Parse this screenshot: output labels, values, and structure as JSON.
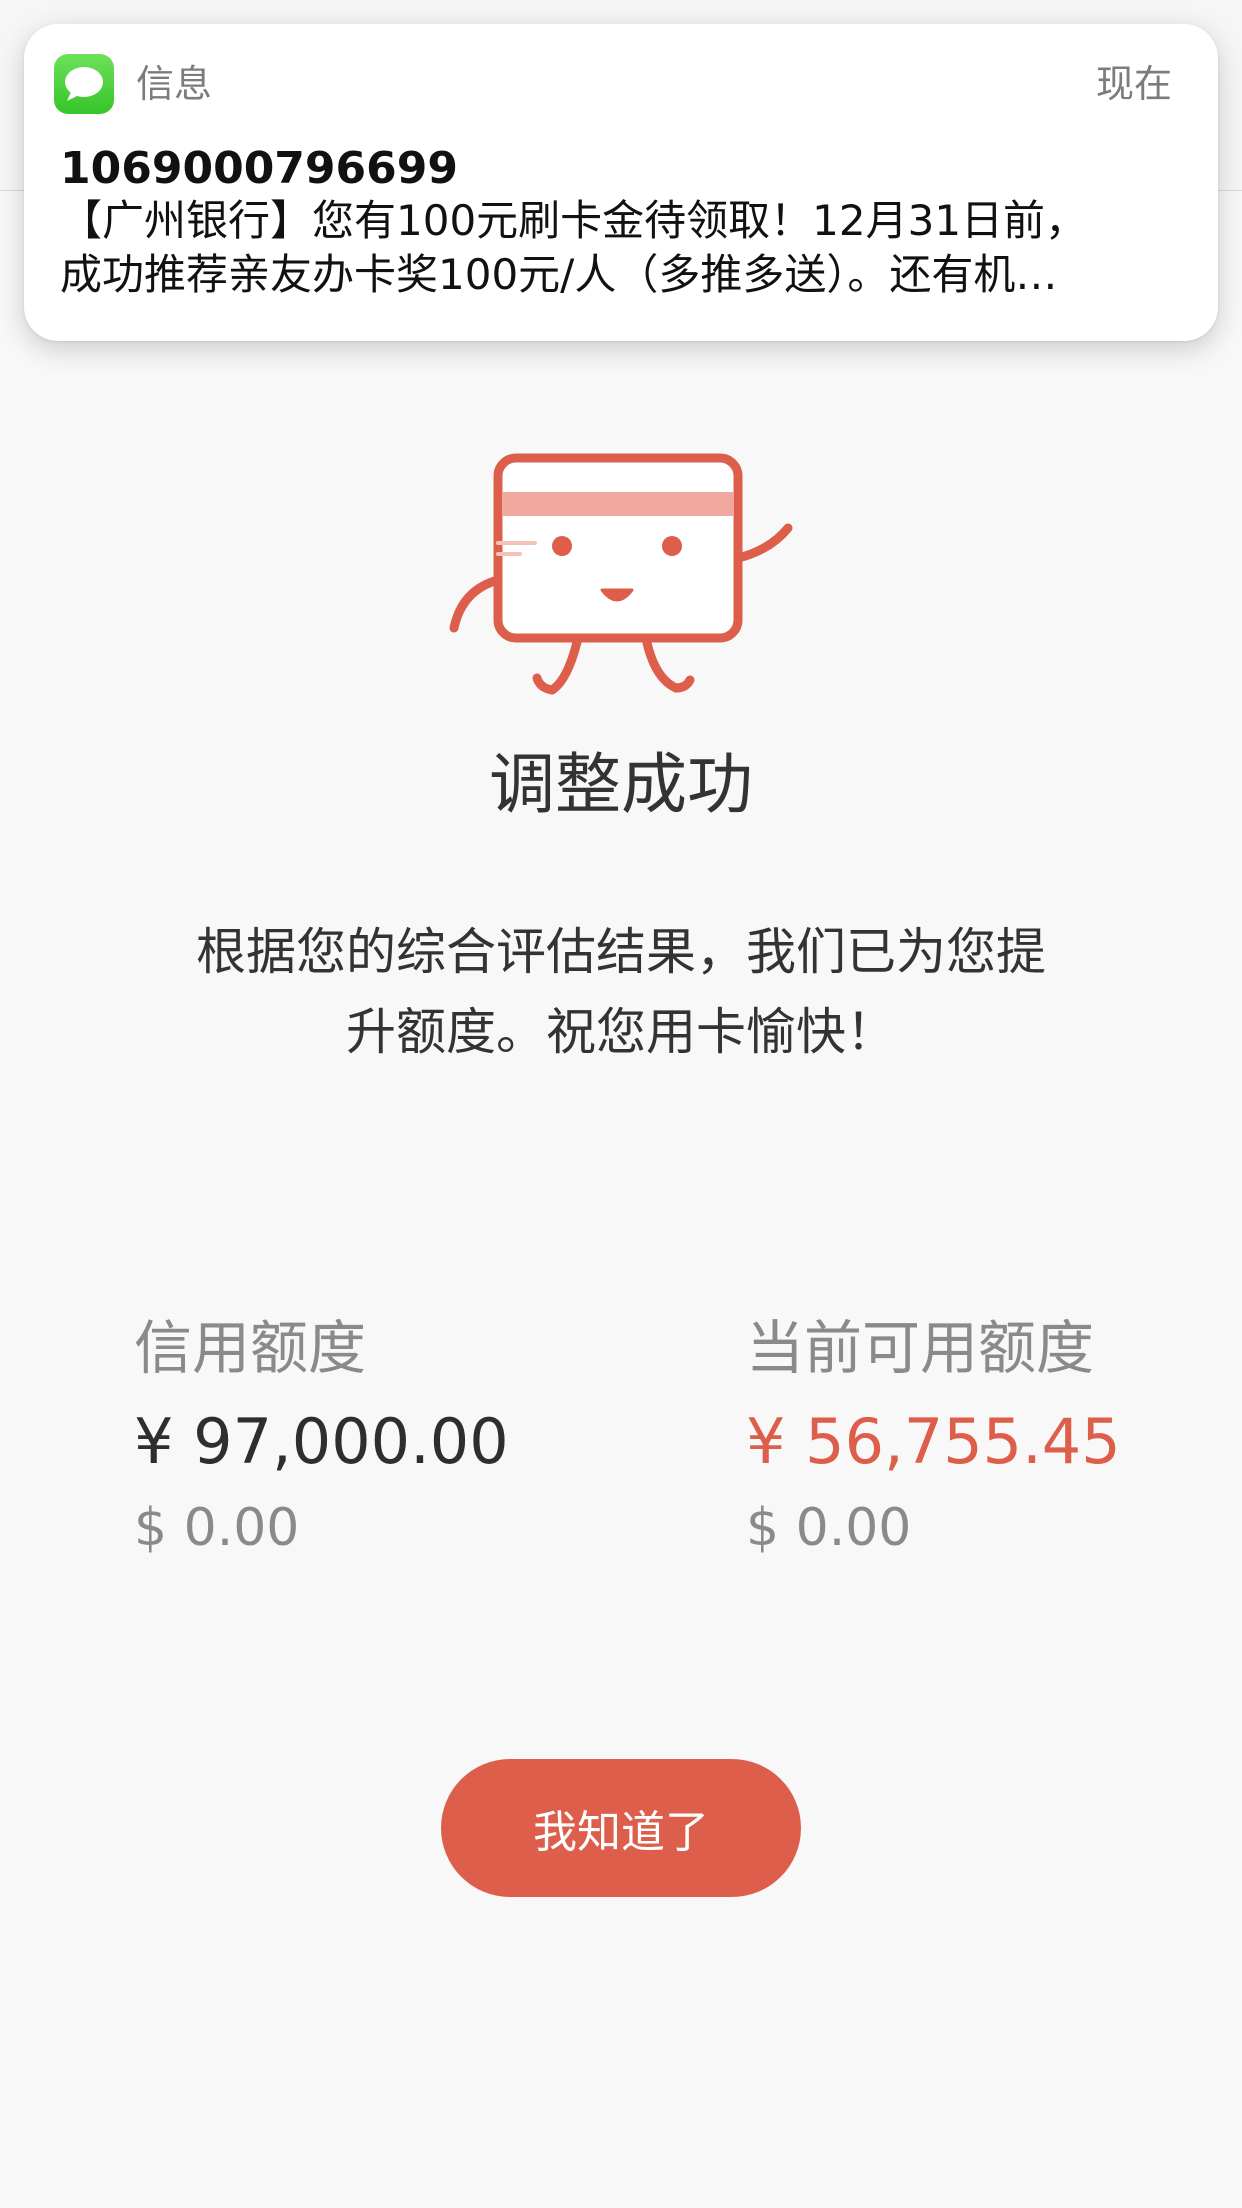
{
  "notification": {
    "app_name": "信息",
    "time": "现在",
    "sender": "1069000796699",
    "body_line1": "【广州银行】您有100元刷卡金待领取！12月31日前，",
    "body_line2": "成功推荐亲友办卡奖100元/人（多推多送）。还有机…",
    "app_icon": "messages-icon"
  },
  "main": {
    "illustration": "card-mascot-icon",
    "title": "调整成功",
    "description_line1": "根据您的综合评估结果，我们已为您提",
    "description_line2": "升额度。祝您用卡愉快！"
  },
  "credit_limit": {
    "label": "信用额度",
    "rmb": "¥ 97,000.00",
    "usd": "$ 0.00"
  },
  "available_limit": {
    "label": "当前可用额度",
    "rmb": "¥ 56,755.45",
    "usd": "$ 0.00"
  },
  "confirm_button": {
    "label": "我知道了"
  },
  "colors": {
    "accent": "#dd5f4b",
    "background": "#f8f8f8"
  }
}
